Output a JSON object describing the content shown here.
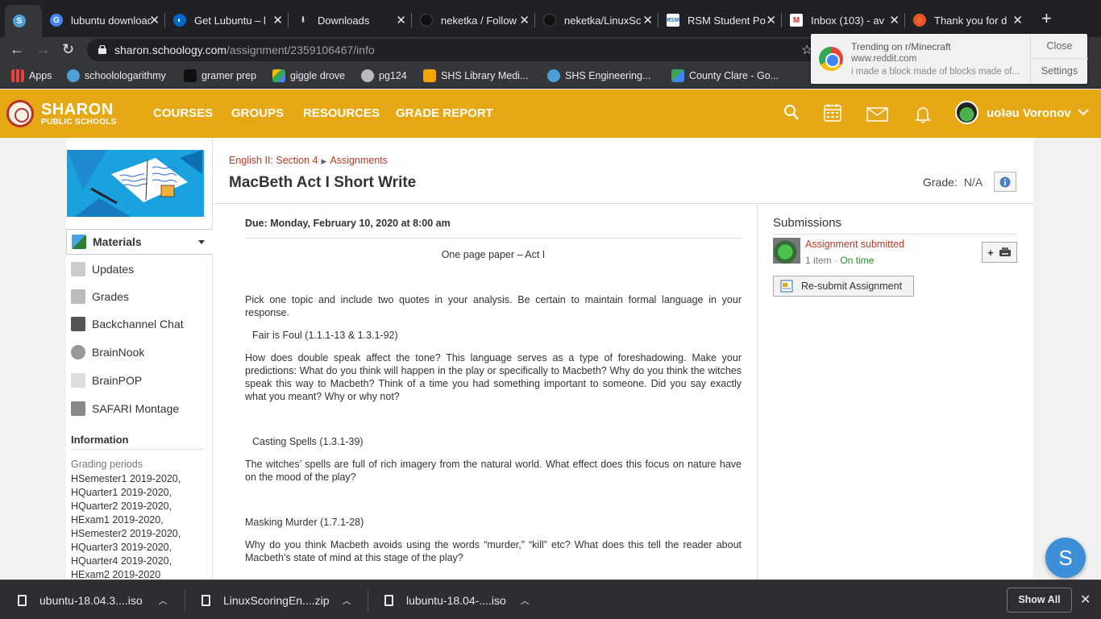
{
  "browser": {
    "tabs": [
      {
        "label": "",
        "active": true
      },
      {
        "label": "lubuntu download"
      },
      {
        "label": "Get Lubuntu – l"
      },
      {
        "label": "Downloads"
      },
      {
        "label": "neketka / Follow"
      },
      {
        "label": "neketka/LinuxSc"
      },
      {
        "label": "RSM Student Po"
      },
      {
        "label": "Inbox (103) - av"
      },
      {
        "label": "Thank you for d"
      }
    ],
    "url_host": "sharon.schoology.com",
    "url_path": "/assignment/2359106467/info",
    "bookmarks": [
      "Apps",
      "schoolologarithmy",
      "gramer prep",
      "giggle drove",
      "pg124",
      "SHS Library Medi...",
      "SHS Engineering...",
      "County Clare - Go..."
    ]
  },
  "notification": {
    "title": "Trending on r/Minecraft",
    "source": "www.reddit.com",
    "message": "i made a block made of blocks made of...",
    "close": "Close",
    "settings": "Settings"
  },
  "header": {
    "logo_name": "SHARON",
    "logo_sub": "PUBLIC SCHOOLS",
    "nav": [
      "COURSES",
      "GROUPS",
      "RESOURCES",
      "GRADE REPORT"
    ],
    "user_name": "uoʇǝu Voronov"
  },
  "sidebar": {
    "items": [
      "Materials",
      "Updates",
      "Grades",
      "Backchannel Chat",
      "BrainNook",
      "BrainPOP",
      "SAFARI Montage"
    ],
    "info_heading": "Information",
    "grading_label": "Grading periods",
    "grading_periods": [
      "HSemester1 2019-2020,",
      "HQuarter1 2019-2020,",
      "HQuarter2 2019-2020,",
      "HExam1 2019-2020,",
      "HSemester2 2019-2020,",
      "HQuarter3 2019-2020,",
      "HQuarter4 2019-2020,",
      "HExam2 2019-2020"
    ]
  },
  "assignment": {
    "breadcrumb_course": "English II: Section 4",
    "breadcrumb_section": "Assignments",
    "title": "MacBeth Act I Short Write",
    "grade_label": "Grade:",
    "grade_value": "N/A",
    "due": "Due: Monday, February 10, 2020 at 8:00 am",
    "subtitle": "One page paper – Act I",
    "intro": "Pick one topic and include two quotes in your analysis.  Be certain to maintain formal language in your response.",
    "topic1_title": "Fair is Foul (1.1.1-13 & 1.3.1-92)",
    "topic1_body": "How does double speak affect the tone?  This language serves as a type of foreshadowing.  Make your predictions: What do you think will happen in the play or specifically to Macbeth?  Why do you think the witches speak this way to Macbeth?  Think of a time you had something important to someone.  Did you say exactly what you meant? Why or why not?",
    "topic2_title": "Casting Spells (1.3.1-39)",
    "topic2_body": "The witches’ spells are full of rich imagery from the natural world.  What effect does this focus on nature have on the mood of the play?",
    "topic3_title": "Masking Murder (1.7.1-28)",
    "topic3_body": "Why do you think Macbeth avoids using the words “murder,” “kill” etc?  What does this tell the reader about Macbeth’s state of mind at this stage of the play?"
  },
  "submissions": {
    "heading": "Submissions",
    "status": "Assignment submitted",
    "count": "1 item",
    "sep": " · ",
    "timing": "On time",
    "resubmit": "Re-submit Assignment"
  },
  "fab_letter": "S",
  "downloads": {
    "items": [
      "ubuntu-18.04.3....iso",
      "LinuxScoringEn....zip",
      "lubuntu-18.04-....iso"
    ],
    "show_all": "Show All"
  },
  "colors": {
    "brand": "#e6a814",
    "link_red": "#b53b2a",
    "ontime_green": "#2e8b2e"
  }
}
